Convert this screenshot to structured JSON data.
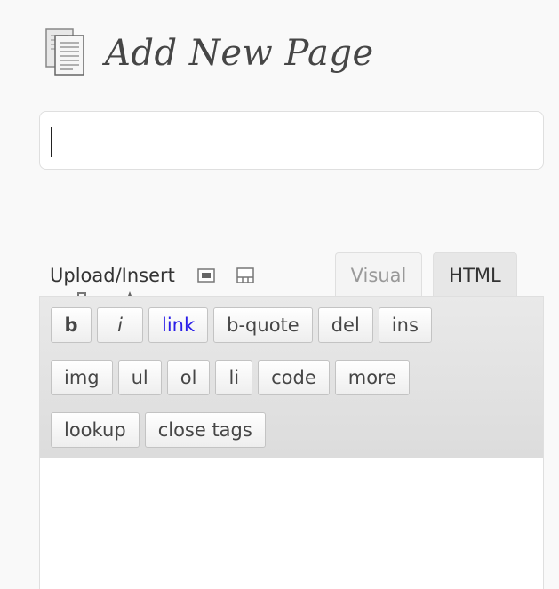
{
  "header": {
    "title": "Add New Page",
    "icon": "pages-icon"
  },
  "title_field": {
    "value": "",
    "placeholder": ""
  },
  "media": {
    "label": "Upload/Insert",
    "buttons": [
      {
        "name": "add-image-icon",
        "icon": "image"
      },
      {
        "name": "add-video-icon",
        "icon": "video"
      },
      {
        "name": "add-audio-icon",
        "icon": "audio"
      },
      {
        "name": "add-media-icon",
        "icon": "media"
      }
    ]
  },
  "tabs": {
    "visual": "Visual",
    "html": "HTML",
    "active": "html"
  },
  "quicktags": {
    "row1": [
      "b",
      "i",
      "link",
      "b-quote",
      "del",
      "ins"
    ],
    "row2": [
      "img",
      "ul",
      "ol",
      "li",
      "code",
      "more"
    ],
    "row3": [
      "lookup",
      "close tags"
    ]
  },
  "editor": {
    "content": ""
  },
  "colors": {
    "background": "#f9f9f9",
    "toolbar": "#e4e4e4",
    "link": "#2a1ee8",
    "title": "#464646"
  }
}
